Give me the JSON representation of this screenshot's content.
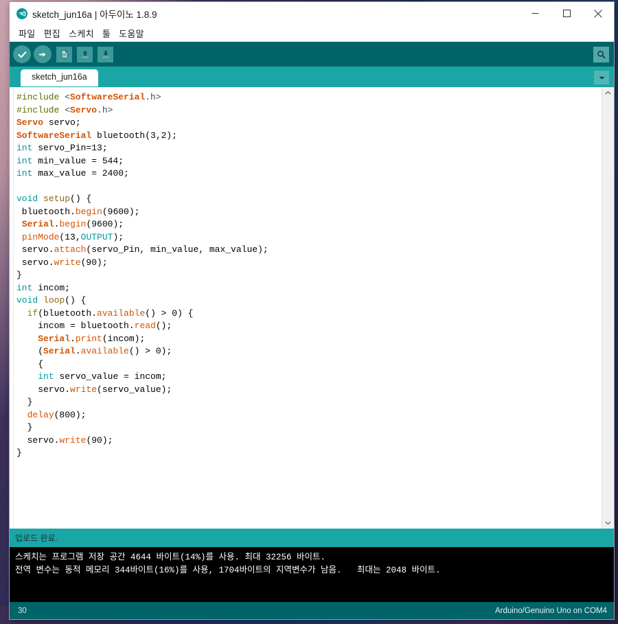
{
  "window": {
    "title": "sketch_jun16a | 아두이노 1.8.9",
    "logo_icon": "arduino-infinity-icon",
    "controls": {
      "minimize_icon": "minimize-icon",
      "maximize_icon": "maximize-icon",
      "close_icon": "close-icon"
    }
  },
  "menubar": {
    "items": [
      {
        "label": "파일"
      },
      {
        "label": "편집"
      },
      {
        "label": "스케치"
      },
      {
        "label": "툴"
      },
      {
        "label": "도움말"
      }
    ]
  },
  "toolbar": {
    "verify_icon": "checkmark-icon",
    "verify_label": "확인",
    "upload_icon": "arrow-right-icon",
    "upload_label": "업로드",
    "new_icon": "new-file-icon",
    "new_label": "새 파일",
    "open_icon": "open-arrow-up-icon",
    "open_label": "열기",
    "save_icon": "save-arrow-down-icon",
    "save_label": "저장",
    "serial_monitor_icon": "magnifier-icon",
    "serial_monitor_label": "시리얼 모니터"
  },
  "tabs": {
    "items": [
      {
        "label": "sketch_jun16a",
        "active": true
      }
    ],
    "menu_icon": "chevron-down-icon"
  },
  "editor": {
    "scrollbar": {
      "up_icon": "chevron-up-icon",
      "down_icon": "chevron-down-icon"
    },
    "lines": [
      [
        {
          "t": "#include ",
          "c": "t-pre"
        },
        {
          "t": "<",
          "c": "t-punct"
        },
        {
          "t": "SoftwareSerial",
          "c": "t-lib"
        },
        {
          "t": ".h>",
          "c": "t-punct"
        }
      ],
      [
        {
          "t": "#include ",
          "c": "t-pre"
        },
        {
          "t": "<",
          "c": "t-punct"
        },
        {
          "t": "Servo",
          "c": "t-lib"
        },
        {
          "t": ".h>",
          "c": "t-punct"
        }
      ],
      [
        {
          "t": "Servo",
          "c": "t-lib"
        },
        {
          "t": " servo;",
          "c": "t-plain"
        }
      ],
      [
        {
          "t": "SoftwareSerial",
          "c": "t-lib"
        },
        {
          "t": " bluetooth(3,2);",
          "c": "t-plain"
        }
      ],
      [
        {
          "t": "int",
          "c": "t-type"
        },
        {
          "t": " servo_Pin=13;",
          "c": "t-plain"
        }
      ],
      [
        {
          "t": "int",
          "c": "t-type"
        },
        {
          "t": " min_value = 544;",
          "c": "t-plain"
        }
      ],
      [
        {
          "t": "int",
          "c": "t-type"
        },
        {
          "t": " max_value = 2400;",
          "c": "t-plain"
        }
      ],
      [
        {
          "t": "",
          "c": "t-plain"
        }
      ],
      [
        {
          "t": "void",
          "c": "t-type"
        },
        {
          "t": " ",
          "c": "t-plain"
        },
        {
          "t": "setup",
          "c": "t-name"
        },
        {
          "t": "() {",
          "c": "t-plain"
        }
      ],
      [
        {
          "t": " bluetooth.",
          "c": "t-plain"
        },
        {
          "t": "begin",
          "c": "t-fn"
        },
        {
          "t": "(9600);",
          "c": "t-plain"
        }
      ],
      [
        {
          "t": " ",
          "c": "t-plain"
        },
        {
          "t": "Serial",
          "c": "t-lib"
        },
        {
          "t": ".",
          "c": "t-plain"
        },
        {
          "t": "begin",
          "c": "t-fn"
        },
        {
          "t": "(9600);",
          "c": "t-plain"
        }
      ],
      [
        {
          "t": " ",
          "c": "t-plain"
        },
        {
          "t": "pinMode",
          "c": "t-fn"
        },
        {
          "t": "(13,",
          "c": "t-plain"
        },
        {
          "t": "OUTPUT",
          "c": "t-const"
        },
        {
          "t": ");",
          "c": "t-plain"
        }
      ],
      [
        {
          "t": " servo.",
          "c": "t-plain"
        },
        {
          "t": "attach",
          "c": "t-fn"
        },
        {
          "t": "(servo_Pin, min_value, max_value);",
          "c": "t-plain"
        }
      ],
      [
        {
          "t": " servo.",
          "c": "t-plain"
        },
        {
          "t": "write",
          "c": "t-fn"
        },
        {
          "t": "(90);",
          "c": "t-plain"
        }
      ],
      [
        {
          "t": "}",
          "c": "t-plain"
        }
      ],
      [
        {
          "t": "int",
          "c": "t-type"
        },
        {
          "t": " incom;",
          "c": "t-plain"
        }
      ],
      [
        {
          "t": "void",
          "c": "t-type"
        },
        {
          "t": " ",
          "c": "t-plain"
        },
        {
          "t": "loop",
          "c": "t-name"
        },
        {
          "t": "() {",
          "c": "t-plain"
        }
      ],
      [
        {
          "t": "  ",
          "c": "t-plain"
        },
        {
          "t": "if",
          "c": "t-kw"
        },
        {
          "t": "(bluetooth.",
          "c": "t-plain"
        },
        {
          "t": "available",
          "c": "t-fn"
        },
        {
          "t": "() > 0) {",
          "c": "t-plain"
        }
      ],
      [
        {
          "t": "    incom = bluetooth.",
          "c": "t-plain"
        },
        {
          "t": "read",
          "c": "t-fn"
        },
        {
          "t": "();",
          "c": "t-plain"
        }
      ],
      [
        {
          "t": "    ",
          "c": "t-plain"
        },
        {
          "t": "Serial",
          "c": "t-lib"
        },
        {
          "t": ".",
          "c": "t-plain"
        },
        {
          "t": "print",
          "c": "t-fn"
        },
        {
          "t": "(incom);",
          "c": "t-plain"
        }
      ],
      [
        {
          "t": "    (",
          "c": "t-plain"
        },
        {
          "t": "Serial",
          "c": "t-lib"
        },
        {
          "t": ".",
          "c": "t-plain"
        },
        {
          "t": "available",
          "c": "t-fn"
        },
        {
          "t": "() > 0);",
          "c": "t-plain"
        }
      ],
      [
        {
          "t": "    {",
          "c": "t-plain"
        }
      ],
      [
        {
          "t": "    ",
          "c": "t-plain"
        },
        {
          "t": "int",
          "c": "t-type"
        },
        {
          "t": " servo_value = incom;",
          "c": "t-plain"
        }
      ],
      [
        {
          "t": "    servo.",
          "c": "t-plain"
        },
        {
          "t": "write",
          "c": "t-fn"
        },
        {
          "t": "(servo_value);",
          "c": "t-plain"
        }
      ],
      [
        {
          "t": "  }",
          "c": "t-plain"
        }
      ],
      [
        {
          "t": "  ",
          "c": "t-plain"
        },
        {
          "t": "delay",
          "c": "t-fn"
        },
        {
          "t": "(800);",
          "c": "t-plain"
        }
      ],
      [
        {
          "t": "  }",
          "c": "t-plain"
        }
      ],
      [
        {
          "t": "  servo.",
          "c": "t-plain"
        },
        {
          "t": "write",
          "c": "t-fn"
        },
        {
          "t": "(90);",
          "c": "t-plain"
        }
      ],
      [
        {
          "t": "}",
          "c": "t-plain"
        }
      ]
    ]
  },
  "status_message": {
    "text": "업로드 완료."
  },
  "console": {
    "lines": [
      "스케치는 프로그램 저장 공간 4644 바이트(14%)를 사용. 최대 32256 바이트.",
      "전역 변수는 동적 메모리 344바이트(16%)를 사용, 1704바이트의 지역변수가 남음.   최대는 2048 바이트."
    ]
  },
  "statusbar": {
    "line_number": "30",
    "board": "Arduino/Genuino Uno on COM4"
  },
  "colors": {
    "toolbar_teal": "#006468",
    "tabstrip_teal": "#1ba6a6",
    "console_bg": "#000000",
    "editor_bg": "#ffffff"
  }
}
